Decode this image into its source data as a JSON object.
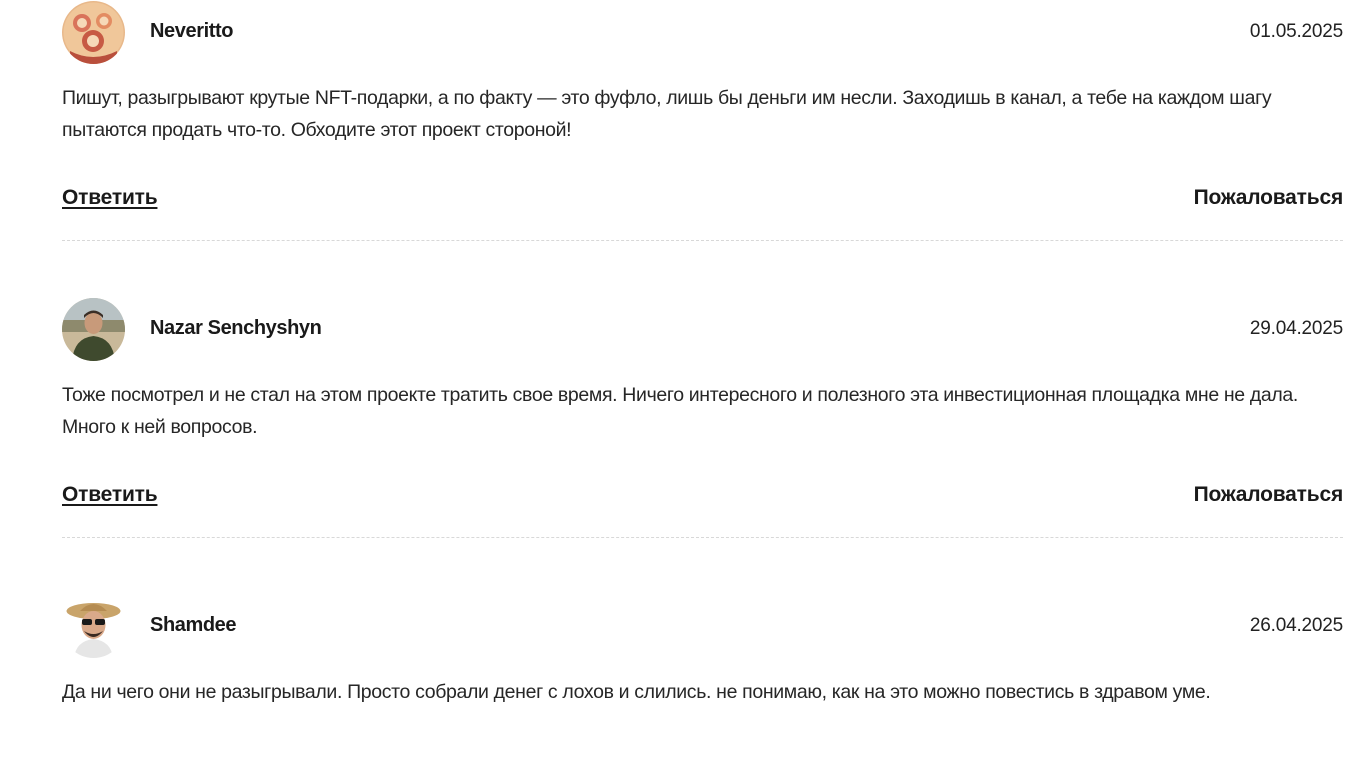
{
  "comments": [
    {
      "author": "Neveritto",
      "date": "01.05.2025",
      "text": "Пишут, разыгрывают крутые NFT-подарки, а по факту — это фуфло, лишь бы деньги им несли. Заходишь в канал, а тебе на каждом шагу пытаются продать что-то. Обходите этот проект стороной!",
      "reply_label": "Ответить",
      "report_label": "Пожаловаться"
    },
    {
      "author": "Nazar Senchyshyn",
      "date": "29.04.2025",
      "text": "Тоже посмотрел и не стал на этом проекте тратить свое время. Ничего интересного и полезного эта инвестиционная площадка мне не дала. Много к ней вопросов.",
      "reply_label": "Ответить",
      "report_label": "Пожаловаться"
    },
    {
      "author": "Shamdee",
      "date": "26.04.2025",
      "text": "Да ни чего они не разыгрывали. Просто собрали денег с лохов и слились. не понимаю, как на это можно повестись в здравом уме."
    }
  ]
}
